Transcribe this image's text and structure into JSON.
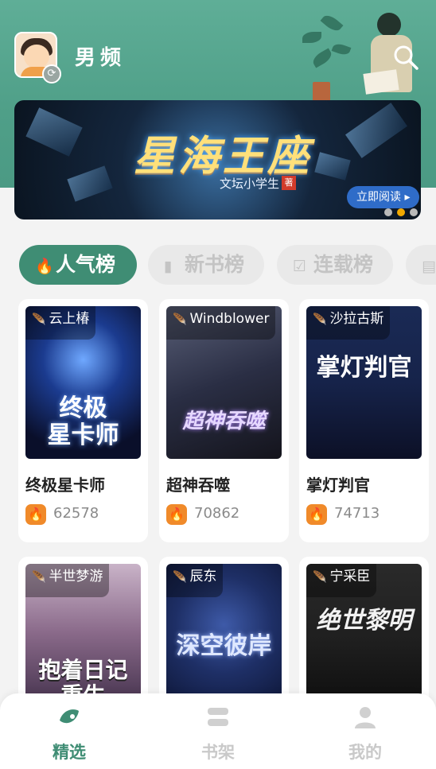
{
  "header": {
    "channel_title": "男频",
    "avatar_label": "avatar",
    "swap_icon": "refresh-icon",
    "search_icon": "search-icon"
  },
  "banner": {
    "title": "星海王座",
    "author": "文坛小学生",
    "author_badge": "著",
    "cta_label": "立即阅读 ▸",
    "carousel": {
      "count": 3,
      "active_index": 1
    }
  },
  "tabs": [
    {
      "label": "人气榜",
      "icon": "fire-icon",
      "active": true
    },
    {
      "label": "新书榜",
      "icon": "book-icon",
      "active": false
    },
    {
      "label": "连载榜",
      "icon": "check-icon",
      "active": false
    },
    {
      "label": "",
      "icon": "document-icon",
      "active": false
    }
  ],
  "books": [
    {
      "title": "终极星卡师",
      "author": "云上椿",
      "hot": "62578",
      "cover_text": "终极\n星卡师",
      "accent": "#1b3b8f"
    },
    {
      "title": "超神吞噬",
      "author": "Windblower",
      "hot": "70862",
      "cover_text": "超神吞噬",
      "accent": "#3a3d52"
    },
    {
      "title": "掌灯判官",
      "author": "沙拉古斯",
      "hot": "74713",
      "cover_text": "掌灯判官",
      "accent": "#16234a"
    },
    {
      "title": "",
      "author": "半世梦游",
      "hot": "",
      "cover_text": "抱着日记\n重生",
      "accent": "#8a6a8a"
    },
    {
      "title": "",
      "author": "辰东",
      "hot": "",
      "cover_text": "深空彼岸",
      "accent": "#1e2f66"
    },
    {
      "title": "",
      "author": "宁采臣",
      "hot": "",
      "cover_text": "绝世黎明",
      "accent": "#1f1f1f"
    }
  ],
  "bottom_nav": [
    {
      "label": "精选",
      "icon": "featured-icon",
      "active": true
    },
    {
      "label": "书架",
      "icon": "bookshelf-icon",
      "active": false
    },
    {
      "label": "我的",
      "icon": "profile-icon",
      "active": false
    }
  ],
  "colors": {
    "brand_green": "#3f8d74",
    "hot_orange": "#f08a2a",
    "carousel_active": "#f2a900"
  }
}
